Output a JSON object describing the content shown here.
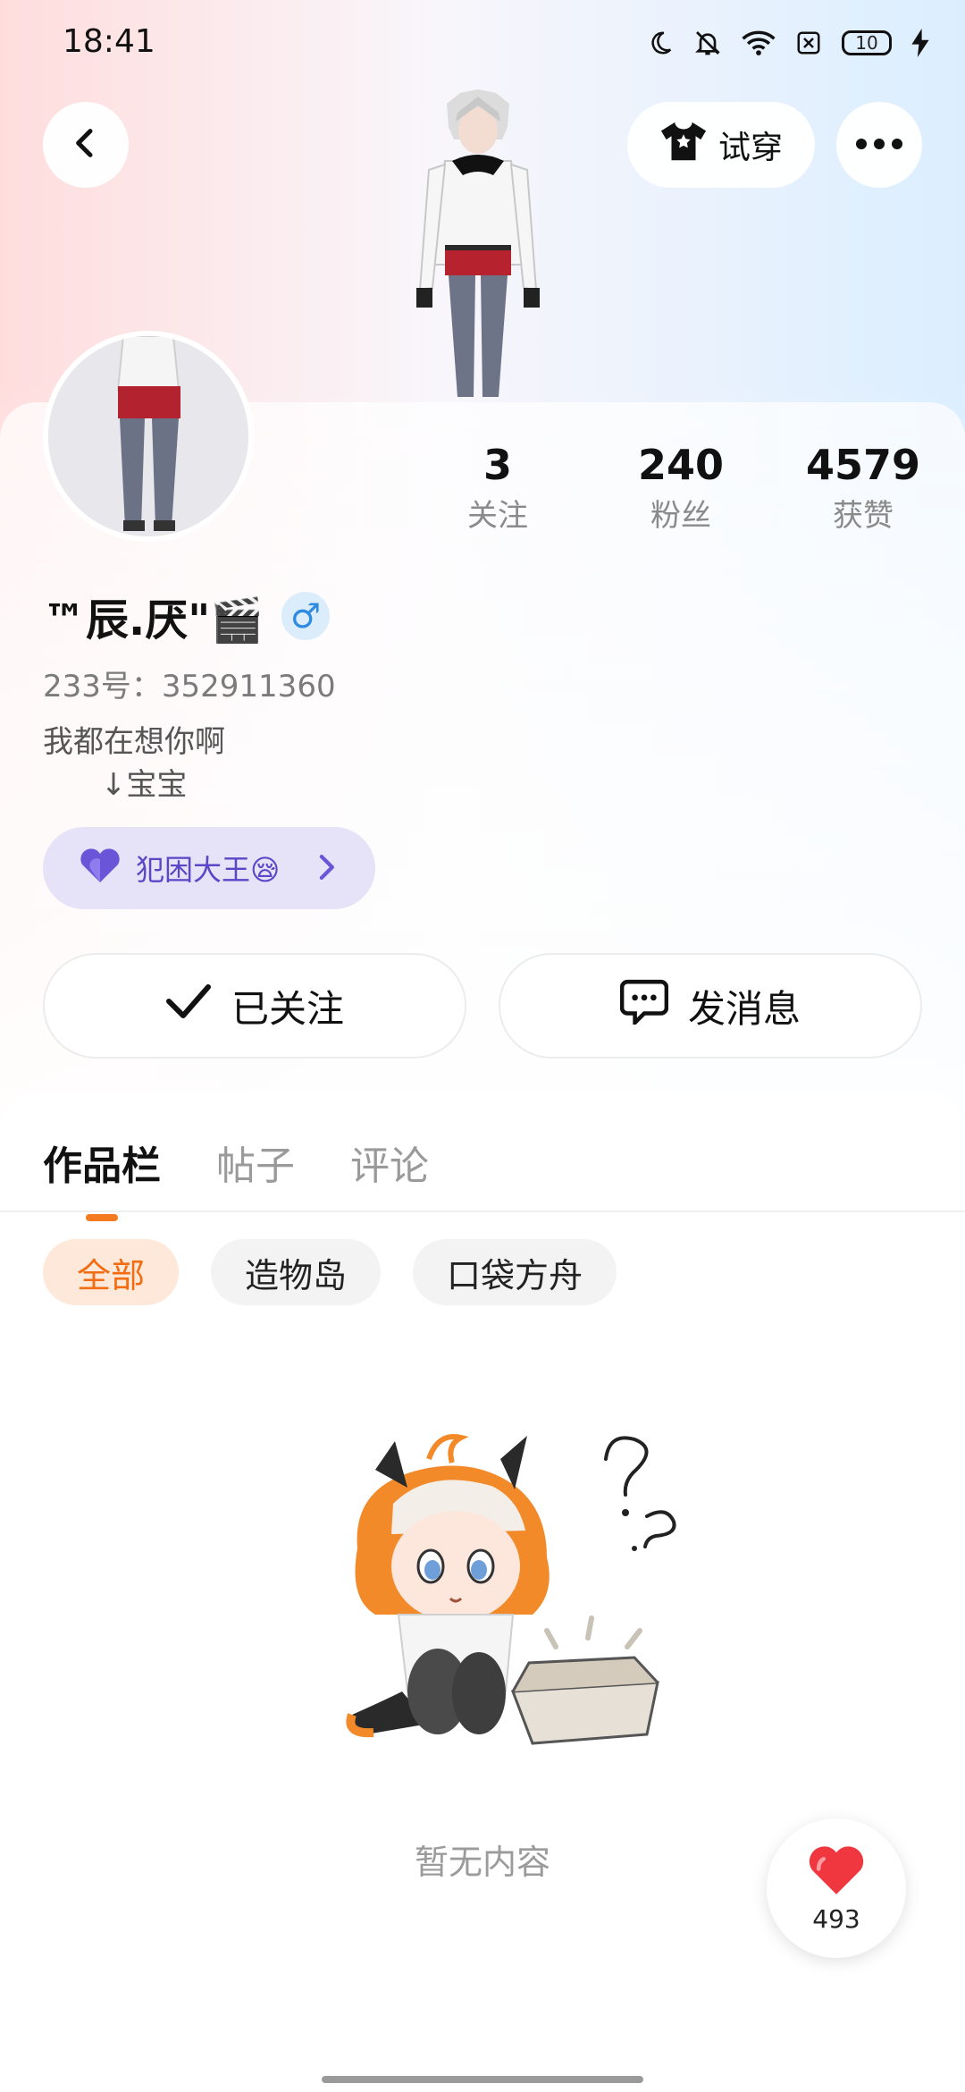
{
  "status_bar": {
    "time": "18:41",
    "battery_level": "10",
    "icons": [
      "moon-icon",
      "bell-off-icon",
      "wifi-icon",
      "sim-off-icon",
      "battery-icon",
      "charging-icon"
    ]
  },
  "header": {
    "tryon_label": "试穿",
    "back_icon": "chevron-left-icon",
    "more_icon": "more-dots-icon"
  },
  "profile": {
    "stats": [
      {
        "value": "3",
        "label": "关注"
      },
      {
        "value": "240",
        "label": "粉丝"
      },
      {
        "value": "4579",
        "label": "获赞"
      }
    ],
    "name": "™辰.厌\"🎬",
    "gender_symbol": "♂",
    "uid": "233号：352911360",
    "bio": "我都在想你啊\n      ↓宝宝",
    "badge": {
      "label": "犯困大王😪",
      "icon": "purple-heart-icon"
    },
    "follow_button": "已关注",
    "message_button": "发消息"
  },
  "tabs": [
    {
      "label": "作品栏",
      "active": true
    },
    {
      "label": "帖子",
      "active": false
    },
    {
      "label": "评论",
      "active": false
    }
  ],
  "filters": [
    {
      "label": "全部",
      "active": true
    },
    {
      "label": "造物岛",
      "active": false
    },
    {
      "label": "口袋方舟",
      "active": false
    }
  ],
  "empty_state": {
    "text": "暂无内容"
  },
  "like_fab": {
    "count": "493"
  },
  "colors": {
    "accent": "#f57b20",
    "badge_text": "#5a46c7",
    "gender": "#2f8be0",
    "like_red": "#f0373f"
  }
}
